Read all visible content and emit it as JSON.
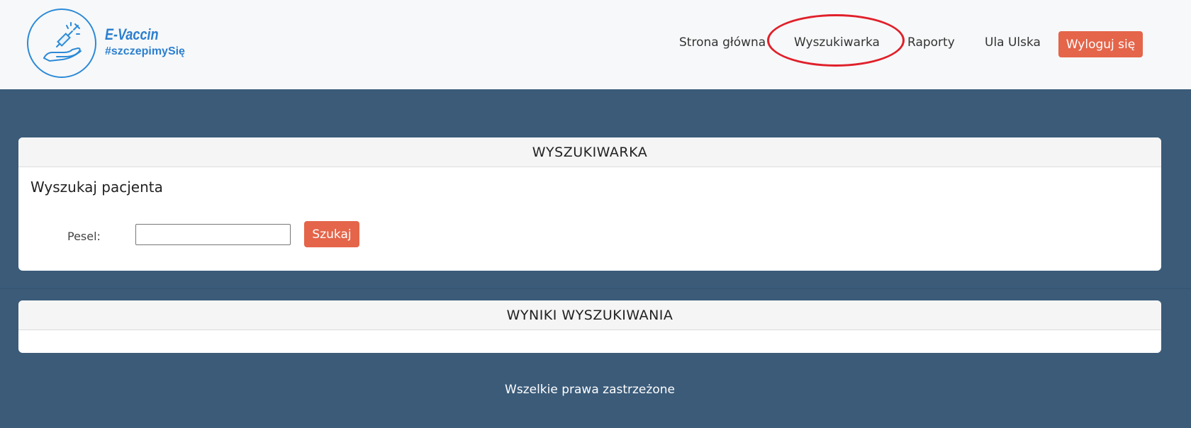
{
  "brand": {
    "name": "E-Vaccin",
    "tagline": "#szczepimySię",
    "accent_color": "#2b7fd0",
    "logo_icon": "hand-with-syringe-icon"
  },
  "nav": {
    "items": [
      {
        "label": "Strona główna"
      },
      {
        "label": "Wyszukiwarka",
        "highlighted": true
      },
      {
        "label": "Raporty"
      },
      {
        "label": "Ula Ulska"
      }
    ],
    "logout_label": "Wyloguj się",
    "button_color": "#e4654a",
    "highlight_color": "#e0202a"
  },
  "search_card": {
    "title": "WYSZUKIWARKA",
    "subheading": "Wyszukaj pacjenta",
    "pesel_label": "Pesel:",
    "pesel_value": "",
    "search_button": "Szukaj"
  },
  "results_card": {
    "title": "WYNIKI WYSZUKIWANIA"
  },
  "footer": {
    "text": "Wszelkie prawa zastrzeżone"
  },
  "colors": {
    "background": "#3b5b79",
    "header_bg": "#f7f8f9"
  }
}
